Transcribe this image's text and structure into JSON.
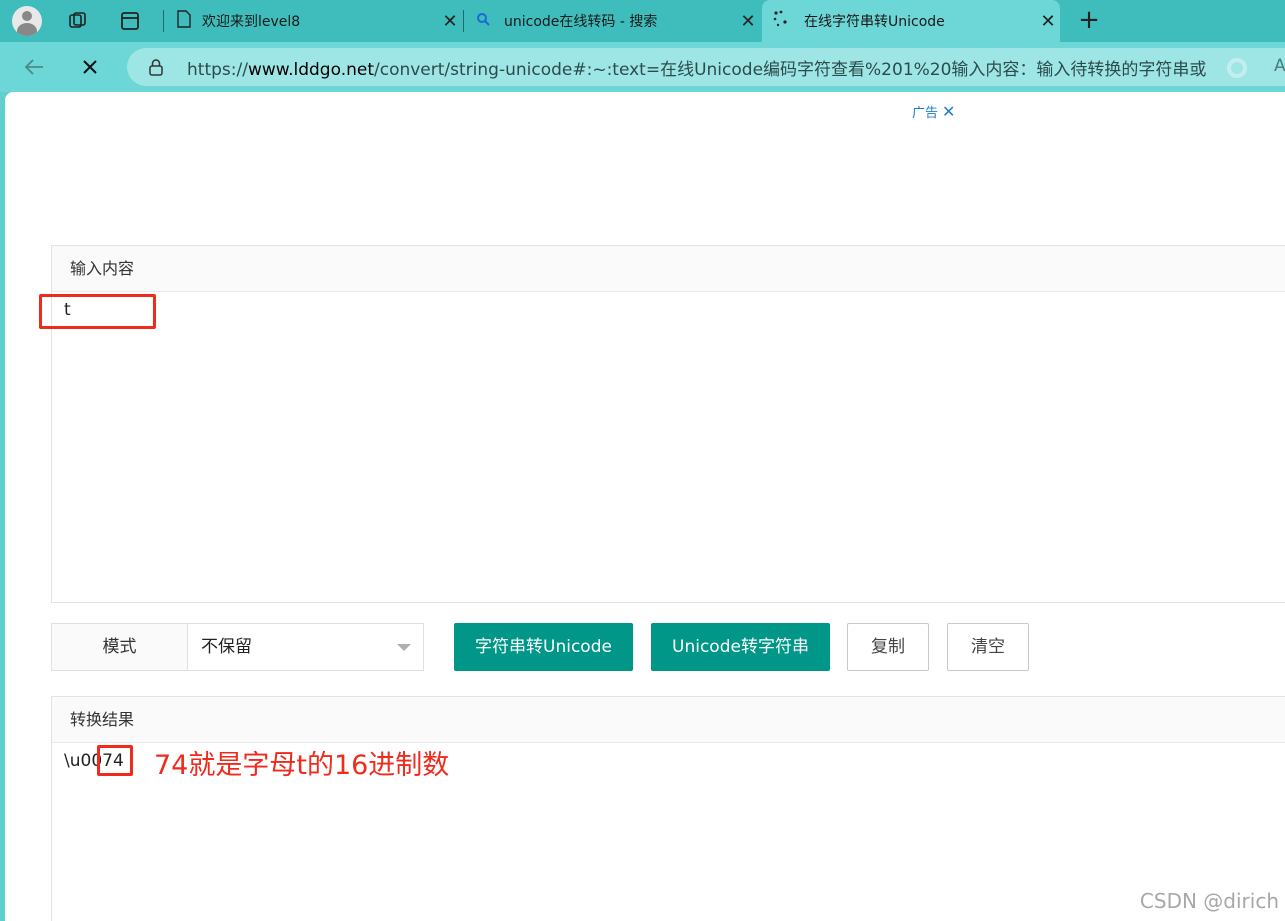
{
  "browser": {
    "tabs": [
      {
        "label": "欢迎来到level8",
        "icon": "page-icon"
      },
      {
        "label": "unicode在线转码 - 搜索",
        "icon": "search-icon"
      },
      {
        "label": "在线字符串转Unicode",
        "icon": "loading-icon",
        "active": true
      }
    ],
    "close_glyph": "✕",
    "new_tab_glyph": "+",
    "url_prefix": "https://",
    "url_domain": "www.lddgo.net",
    "url_rest": "/convert/string-unicode#:~:text=在线Unicode编码字符查看%201%20输入内容：输入待转换的字符串或者%...",
    "reader_mode_label": "A"
  },
  "ad": {
    "label": "广告",
    "close_glyph": "✕"
  },
  "input_panel": {
    "title": "输入内容",
    "value": "t"
  },
  "controls": {
    "mode_label": "模式",
    "mode_value": "不保留",
    "btn_to_unicode": "字符串转Unicode",
    "btn_to_string": "Unicode转字符串",
    "btn_copy": "复制",
    "btn_clear": "清空"
  },
  "output_panel": {
    "title": "转换结果",
    "value": "\\u0074",
    "annotation": "74就是字母t的16进制数"
  },
  "watermark": "CSDN @dirich",
  "colors": {
    "accent": "#009688",
    "annotation": "#ee2b1c",
    "tabbar": "#3fbcbc"
  }
}
